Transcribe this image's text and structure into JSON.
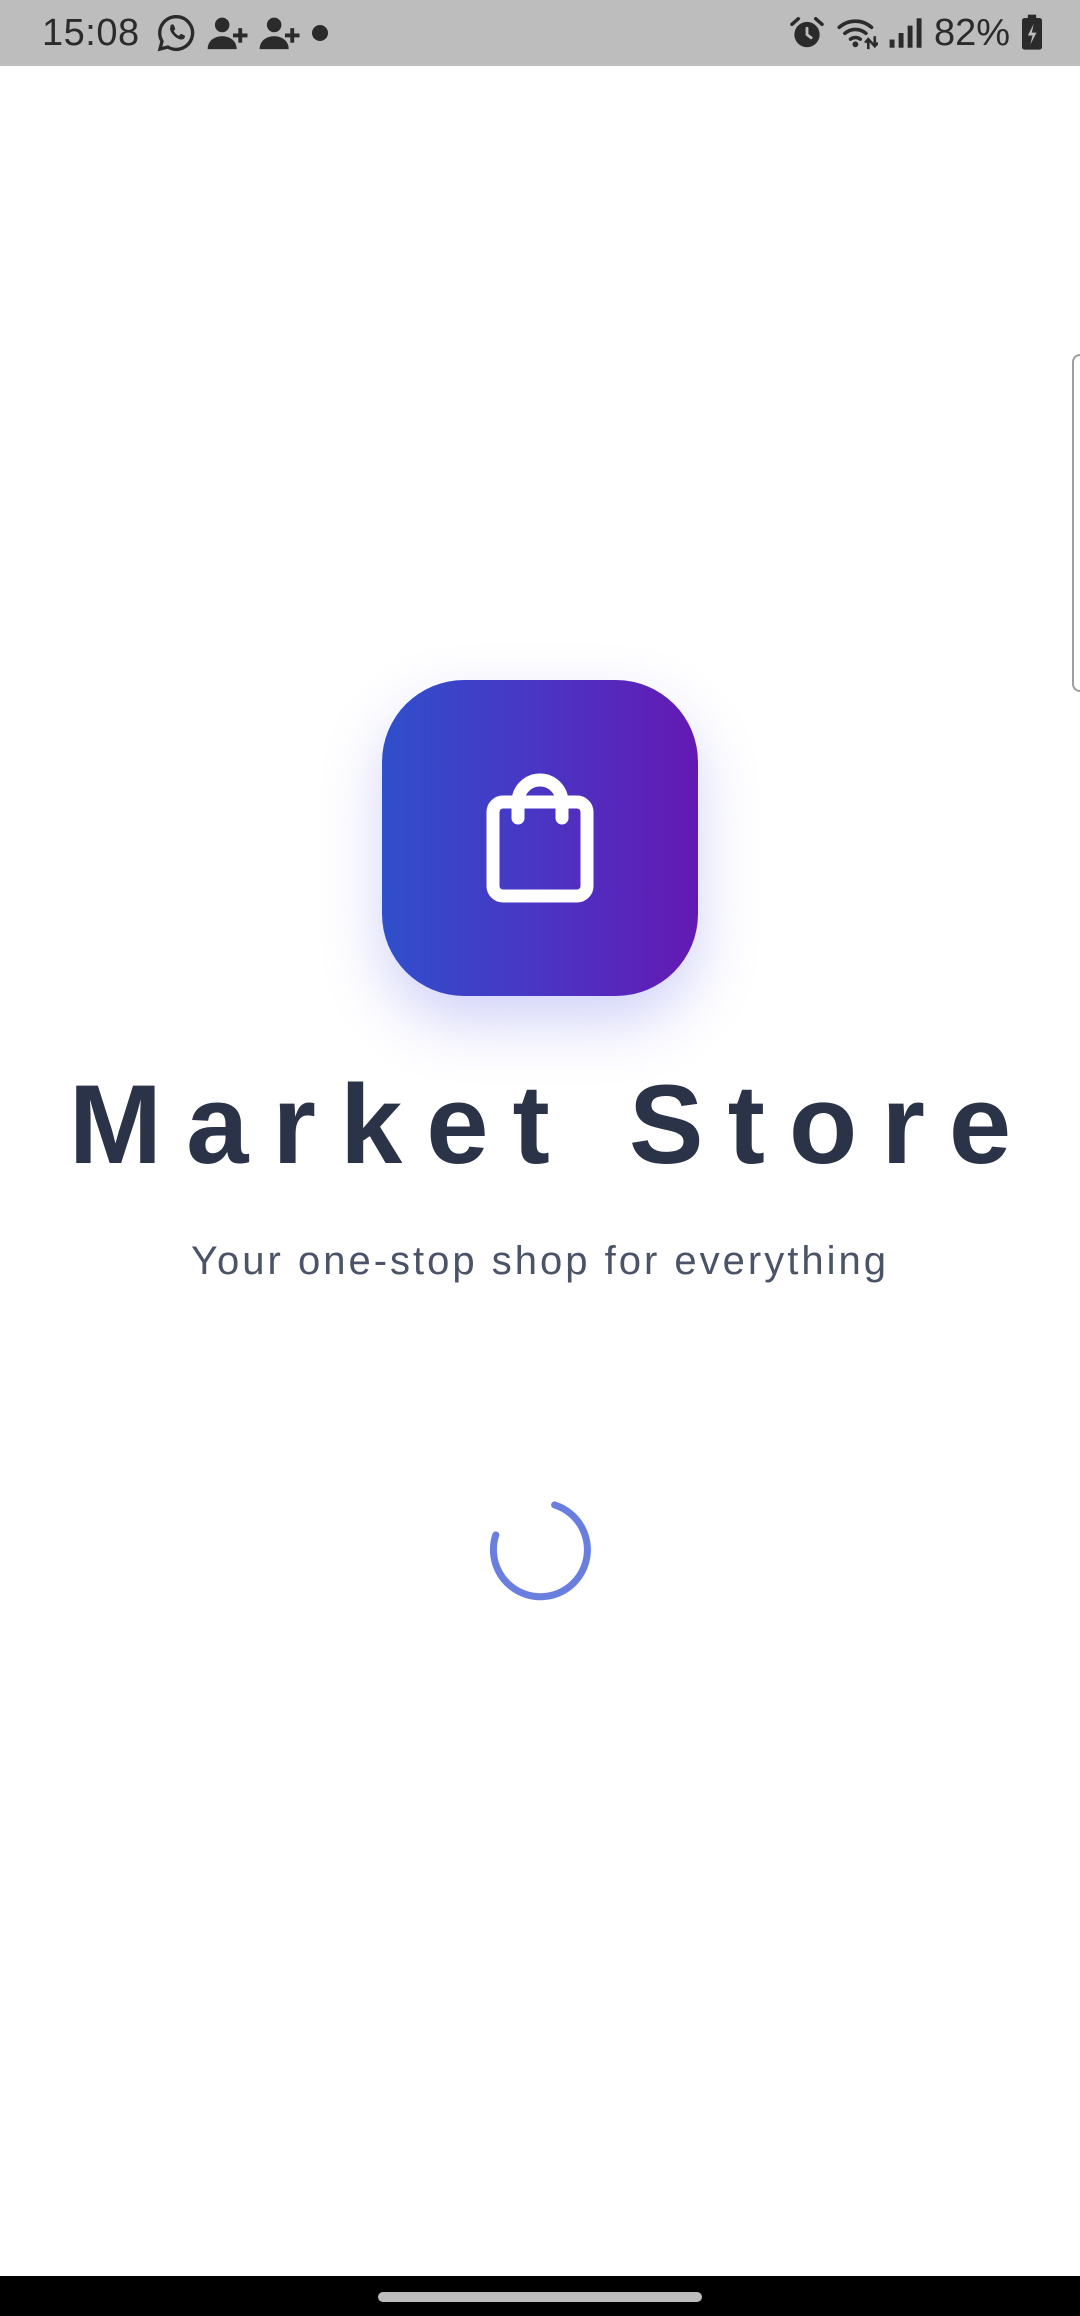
{
  "status_bar": {
    "time": "15:08",
    "battery_percent": "82%",
    "left_icons": [
      "whatsapp-icon",
      "person-add-icon",
      "person-add-icon",
      "notification-dot-icon"
    ],
    "right_icons": [
      "alarm-icon",
      "wifi-icon",
      "signal-icon",
      "battery-charging-icon"
    ],
    "background_color": "#bdbdbd"
  },
  "splash": {
    "logo_icon": "shopping-bag-icon",
    "gradient_colors": [
      "#2f4fcb",
      "#6419b3"
    ],
    "title": "Market Store",
    "subtitle": "Your one-stop shop for everything",
    "spinner_color": "#6a7ee0"
  },
  "nav_bar": {
    "background_color": "#000000"
  }
}
